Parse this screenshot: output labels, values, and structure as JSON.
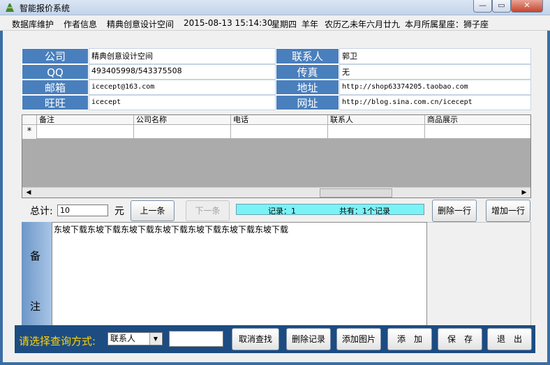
{
  "window": {
    "title": "智能报价系统",
    "controls": {
      "minimize": "—",
      "maximize": "▭",
      "close": "✕"
    }
  },
  "menubar": {
    "items": [
      "数据库维护",
      "作者信息",
      "精典创意设计空间"
    ],
    "datetime": "2015-08-13 15:14:30",
    "weekday": "星期四",
    "zodiac_year": "羊年",
    "lunar_date": "农历乙未年六月廿九",
    "constellation": "本月所属星座：狮子座"
  },
  "info": {
    "company_label": "公司",
    "company_value": "精典创意设计空间",
    "contact_label": "联系人",
    "contact_value": "郭卫",
    "qq_label": "QQ",
    "qq_value": "493405998/543375508",
    "fax_label": "传真",
    "fax_value": "无",
    "email_label": "邮箱",
    "email_value": "icecept@163.com",
    "address_label": "地址",
    "address_value": "http://shop63374205.taobao.com",
    "wangwang_label": "旺旺",
    "wangwang_value": "icecept",
    "website_label": "网址",
    "website_value": "http://blog.sina.com.cn/icecept"
  },
  "grid": {
    "columns": [
      "备注",
      "公司名称",
      "电话",
      "联系人",
      "商品展示"
    ],
    "new_row_marker": "*"
  },
  "totals": {
    "total_label": "总计:",
    "total_value": "10",
    "currency": "元",
    "prev_button": "上一条",
    "next_button": "下一条",
    "record_text": "记录：1",
    "count_text": "共有：1个记录",
    "delete_row_button": "删除一行",
    "add_row_button": "增加一行"
  },
  "notes": {
    "label_top": "备",
    "label_bottom": "注",
    "content": "东坡下载东坡下载东坡下载东坡下载东坡下载东坡下载东坡下载"
  },
  "bottom": {
    "query_label": "请选择查询方式:",
    "query_select": "联系人",
    "query_input": "",
    "buttons": {
      "cancel_search": "取消查找",
      "delete_record": "删除记录",
      "add_picture": "添加图片",
      "add": "添　加",
      "save": "保　存",
      "exit": "退　出"
    }
  },
  "colors": {
    "label_blue": "#4a7fbd",
    "bottom_bar": "#1c4c82",
    "status_cyan": "#79f3f5",
    "query_label": "#ffd400"
  },
  "icons": [
    "app-icon",
    "row-indicator-icon",
    "scroll-left-icon",
    "scroll-right-icon",
    "dropdown-arrow-icon"
  ]
}
